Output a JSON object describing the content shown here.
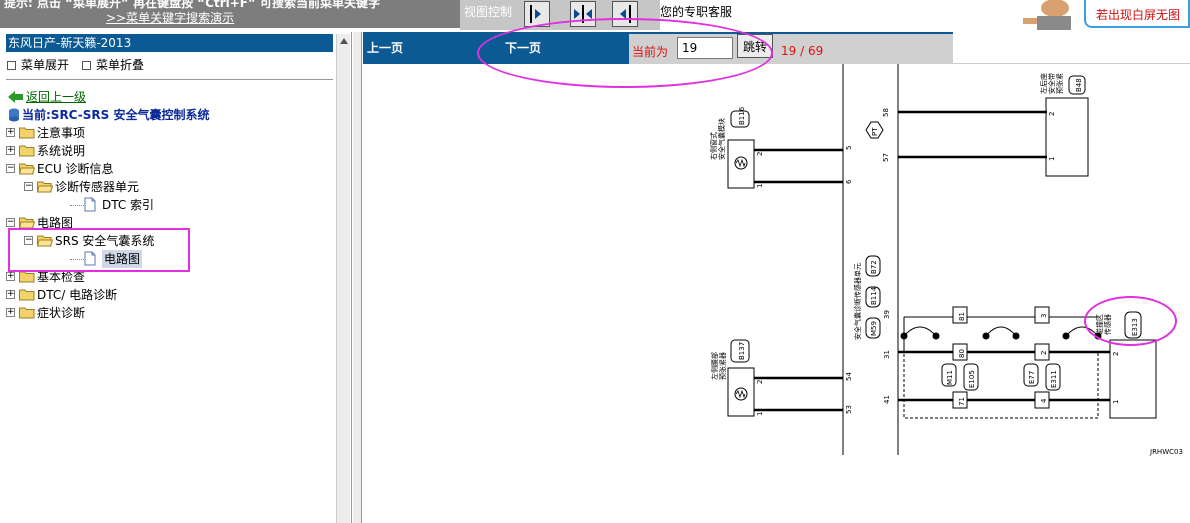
{
  "top": {
    "tip_text": "提示: 点击 “菜单展开” 再在键盘按 “Ctrl+F” 可搜索当前菜单关键字",
    "tip_link": ">>菜单关键字搜索演示",
    "view_control_label": "视图控制",
    "view_buttons": [
      "left-pane-icon",
      "split-pane-icon",
      "right-pane-icon"
    ],
    "support_text": "您的专职客服",
    "notice_text": "若出现白屏无图"
  },
  "sidebar": {
    "title": "东风日产-新天籁-2013",
    "expand_all": "菜单展开",
    "collapse_all": "菜单折叠",
    "back_link": "返回上一级",
    "current": "当前:SRC-SRS 安全气囊控制系统",
    "tree": [
      {
        "label": "注意事项",
        "level": 0,
        "expander": "+",
        "type": "folder"
      },
      {
        "label": "系统说明",
        "level": 0,
        "expander": "+",
        "type": "folder"
      },
      {
        "label": "ECU 诊断信息",
        "level": 0,
        "expander": "-",
        "type": "folder-open"
      },
      {
        "label": "诊断传感器单元",
        "level": 1,
        "expander": "-",
        "type": "folder-open"
      },
      {
        "label": "DTC 索引",
        "level": 2,
        "expander": "",
        "type": "doc"
      },
      {
        "label": "电路图",
        "level": 0,
        "expander": "-",
        "type": "folder-open"
      },
      {
        "label": "SRS 安全气囊系统",
        "level": 1,
        "expander": "-",
        "type": "folder-open"
      },
      {
        "label": "电路图",
        "level": 2,
        "expander": "",
        "type": "doc",
        "selected": true
      },
      {
        "label": "基本检查",
        "level": 0,
        "expander": "+",
        "type": "folder"
      },
      {
        "label": "DTC/ 电路诊断",
        "level": 0,
        "expander": "+",
        "type": "folder"
      },
      {
        "label": "症状诊断",
        "level": 0,
        "expander": "+",
        "type": "folder"
      }
    ]
  },
  "viewer": {
    "prev_page": "上一页",
    "next_page": "下一页",
    "current_label": "当前为",
    "page_value": "19",
    "jump_button": "跳转",
    "page_count": "19 / 69"
  },
  "diagram": {
    "left_top_component": "右侧窗式\n安全气囊模块",
    "left_top_connector": "B116",
    "left_bottom_component": "左侧腰部\n预张紧器",
    "left_bottom_connector": "B137",
    "center_label": "安全气囊诊断传感器单元",
    "center_connectors": [
      "M59",
      "B114",
      "B72"
    ],
    "pt_tag": "PT",
    "right_top_component": "左后座\n安全带\n预张紧",
    "right_top_connector": "B48",
    "right_bottom_component": "碰撞区\n传感器",
    "right_bottom_connector": "E313",
    "pins": {
      "p58": "58",
      "p57": "57",
      "p5": "5",
      "p6": "6",
      "p39": "39",
      "p31": "31",
      "p41": "41",
      "p54": "54",
      "p53": "53"
    },
    "module_pins": [
      "2",
      "1",
      "2",
      "1",
      "2",
      "1"
    ],
    "inline_top": [
      "81",
      "3"
    ],
    "inline_mid": [
      "80",
      "2"
    ],
    "inline_bot": [
      "71",
      "4"
    ],
    "inline_connectors_left": [
      "M11",
      "E105"
    ],
    "inline_connectors_right": [
      "E77",
      "E311"
    ],
    "figure_code": "JRHWC03"
  },
  "colors": {
    "title_bar": "#0c5a94",
    "highlight": "#e030e0",
    "alert_red": "#e01010"
  }
}
